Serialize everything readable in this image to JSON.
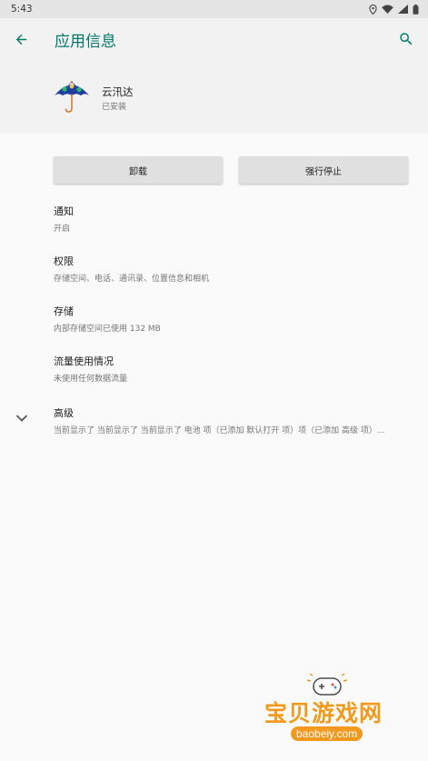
{
  "status_bar": {
    "time": "5:43",
    "icons": [
      "location-icon",
      "wifi-icon",
      "signal-icon",
      "battery-icon"
    ]
  },
  "app_bar": {
    "title": "应用信息",
    "back_icon": "arrow-back-icon",
    "search_icon": "search-icon",
    "accent_color": "#00796b"
  },
  "app": {
    "name": "云汛达",
    "status": "已安装",
    "icon": "umbrella-icon"
  },
  "buttons": {
    "uninstall": "卸载",
    "force_stop": "强行停止"
  },
  "preferences": [
    {
      "title": "通知",
      "summary": "开启"
    },
    {
      "title": "权限",
      "summary": "存储空间、电话、通讯录、位置信息和相机"
    },
    {
      "title": "存储",
      "summary": "内部存储空间已使用 132 MB"
    },
    {
      "title": "流量使用情况",
      "summary": "未使用任何数据流量"
    },
    {
      "title": "高级",
      "summary": "当前显示了 当前显示了 当前显示了 电池 项（已添加 默认打开 项）项（已添加 高级 项）..."
    }
  ],
  "watermark": {
    "title": "宝贝游戏网",
    "url": "baobeiy.com"
  }
}
